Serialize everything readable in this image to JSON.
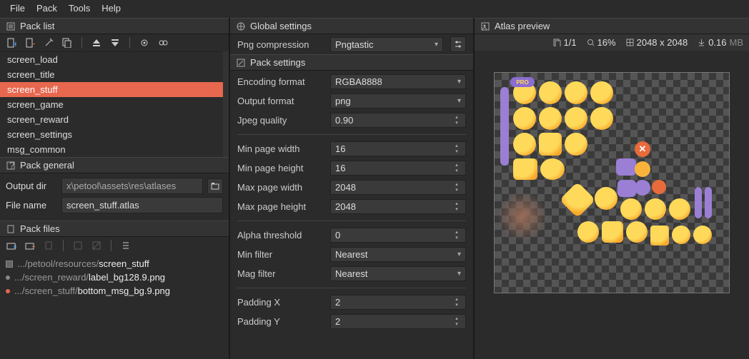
{
  "menu": {
    "file": "File",
    "pack": "Pack",
    "tools": "Tools",
    "help": "Help"
  },
  "panels": {
    "pack_list": "Pack list",
    "pack_general": "Pack general",
    "pack_files": "Pack files",
    "global": "Global settings",
    "pack_settings": "Pack settings",
    "atlas_preview": "Atlas preview"
  },
  "pack_list": {
    "items": [
      {
        "name": "screen_load"
      },
      {
        "name": "screen_title"
      },
      {
        "name": "screen_stuff",
        "selected": true
      },
      {
        "name": "screen_game"
      },
      {
        "name": "screen_reward"
      },
      {
        "name": "screen_settings"
      },
      {
        "name": "msg_common"
      }
    ]
  },
  "general": {
    "output_dir_label": "Output dir",
    "output_dir": "x\\petool\\assets\\res\\atlases",
    "file_name_label": "File name",
    "file_name_placeholder": "screen_stuff.atlas"
  },
  "files": [
    {
      "marker": "folder",
      "prefix": ".../petool/resources/",
      "name": "screen_stuff"
    },
    {
      "marker": "grey",
      "prefix": ".../screen_reward/",
      "name": "label_bg128.9.png"
    },
    {
      "marker": "red",
      "prefix": ".../screen_stuff/",
      "name": "bottom_msg_bg.9.png"
    }
  ],
  "global": {
    "png_compression_label": "Png compression",
    "png_compression": "Pngtastic"
  },
  "settings": {
    "encoding_label": "Encoding format",
    "encoding": "RGBA8888",
    "output_label": "Output format",
    "output": "png",
    "jpeg_label": "Jpeg quality",
    "jpeg": "0.90",
    "minw_label": "Min page width",
    "minw": "16",
    "minh_label": "Min page height",
    "minh": "16",
    "maxw_label": "Max page width",
    "maxw": "2048",
    "maxh_label": "Max page height",
    "maxh": "2048",
    "alpha_label": "Alpha threshold",
    "alpha": "0",
    "minf_label": "Min filter",
    "minf": "Nearest",
    "magf_label": "Mag filter",
    "magf": "Nearest",
    "padx_label": "Padding X",
    "padx": "2",
    "pady_label": "Padding Y",
    "pady": "2"
  },
  "preview": {
    "pages": "1/1",
    "zoom": "16%",
    "dims": "2048 x 2048",
    "size": "0.16",
    "size_unit": "MB"
  }
}
